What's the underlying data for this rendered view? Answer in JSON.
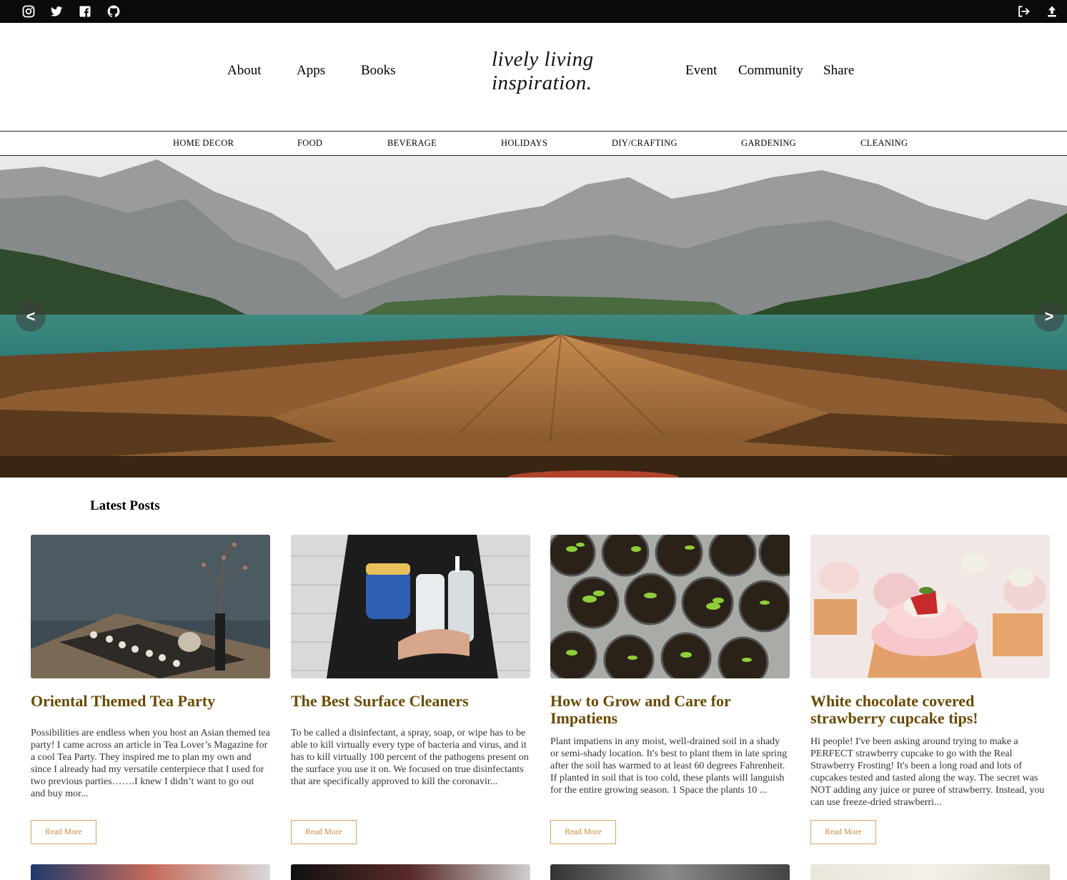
{
  "social": {
    "icons": [
      "instagram-icon",
      "twitter-icon",
      "facebook-icon",
      "github-icon"
    ],
    "right_icons": [
      "logout-icon",
      "upload-icon"
    ]
  },
  "header": {
    "nav_left": [
      "About",
      "Apps",
      "Books"
    ],
    "logo_line1": "lively living",
    "logo_line2": "inspiration.",
    "nav_right": [
      "Event",
      "Community",
      "Share"
    ]
  },
  "categories": [
    "HOME DECOR",
    "FOOD",
    "BEVERAGE",
    "HOLIDAYS",
    "DIY/CRAFTING",
    "GARDENING",
    "CLEANING"
  ],
  "hero": {
    "prev_label": "<",
    "next_label": ">"
  },
  "latest": {
    "title": "Latest Posts",
    "posts": [
      {
        "title": "Oriental Themed Tea Party",
        "excerpt": "Possibilities are endless when you host an Asian themed tea party! I came across an article in Tea Lover’s Magazine for a cool Tea Party. They inspired me to plan my own and since I already had my versatile centerpiece that I used for two previous parties…….I knew I didn’t want to go out and buy mor...",
        "button": "Read More"
      },
      {
        "title": "The Best Surface Cleaners",
        "excerpt": "To be called a disinfectant, a spray, soap, or wipe has to be able to kill virtually every type of bacteria and virus, and it has to kill virtually 100 percent of the pathogens present on the surface you use it on. We focused on true disinfectants that are specifically approved to kill the coronavir...",
        "button": "Read More"
      },
      {
        "title": "How to Grow and Care for Impatiens",
        "excerpt": "Plant impatiens in any moist, well-drained soil in a shady or semi-shady location. It's best to plant them in late spring after the soil has warmed to at least 60 degrees Fahrenheit. If planted in soil that is too cold, these plants will languish for the entire growing season. 1 Space the plants 10 ...",
        "button": "Read More"
      },
      {
        "title": "White chocolate covered strawberry cupcake tips!",
        "excerpt": "Hi people! I've been asking around trying to make a PERFECT strawberry cupcake to go with the Real Strawberry Frosting! It's been a long road and lots of cupcakes tested and tasted along the way. The secret was NOT adding any juice or puree of strawberry. Instead, you can use freeze-dried strawberri...",
        "button": "Read More"
      }
    ]
  },
  "colors": {
    "topbar": "#0b0b0b",
    "post_title": "#6a4a00",
    "button_border": "#d9a45c",
    "button_text": "#c98a36"
  }
}
